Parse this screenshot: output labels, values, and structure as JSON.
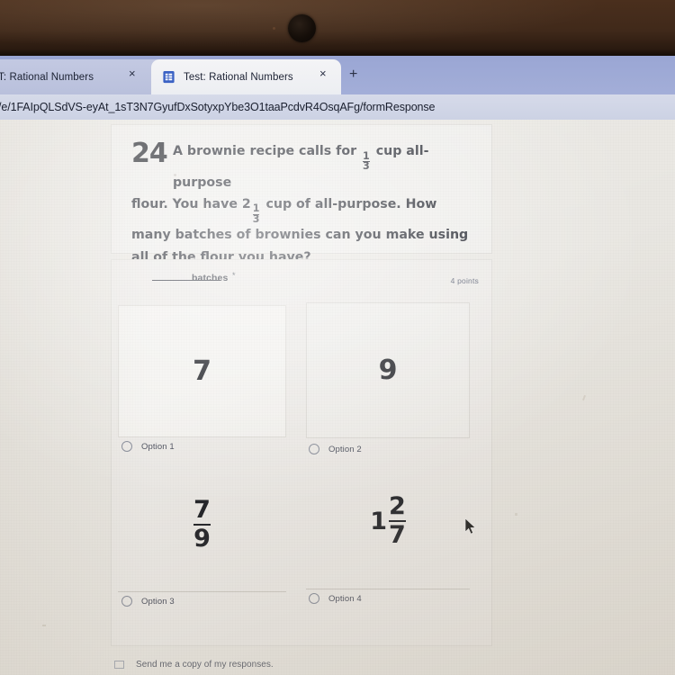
{
  "browser": {
    "tabs": [
      {
        "title": "T: Rational Numbers",
        "favicon": "forms-icon",
        "active": false,
        "close_label": "×"
      },
      {
        "title": "Test: Rational Numbers",
        "favicon": "forms-icon",
        "active": true,
        "close_label": "×"
      }
    ],
    "new_tab_label": "+",
    "url": "/e/1FAIpQLSdVS-eyAt_1sT3N7GyufDxSotyxpYbe3O1taaPcdvR4OsqAFg/formResponse"
  },
  "question": {
    "number": "24",
    "line1_pre": "A brownie recipe calls for",
    "frac1_num": "1",
    "frac1_den": "3",
    "line1_post": "cup all-purpose",
    "line2_pre": "flour.  You have 2",
    "frac2_num": "1",
    "frac2_den": "3",
    "line2_post": "cup of all-purpose.  How",
    "line3": "many batches of brownies can you make using",
    "line4": "all of the flour you have?"
  },
  "answer": {
    "label": "batches",
    "required_marker": "*",
    "points": "4 points",
    "options": [
      {
        "label": "Option 1",
        "kind": "integer",
        "value": "7"
      },
      {
        "label": "Option 2",
        "kind": "integer",
        "value": "9"
      },
      {
        "label": "Option 3",
        "kind": "fraction",
        "whole": "",
        "numerator": "7",
        "denominator": "9"
      },
      {
        "label": "Option 4",
        "kind": "mixed",
        "whole": "1",
        "numerator": "2",
        "denominator": "7"
      }
    ]
  },
  "footer": {
    "send_copy_label": "Send me a copy of my responses."
  },
  "colors": {
    "tabstrip": "#9aa6d4",
    "urlbar": "#d6dae9",
    "page_background": "#e9e7e2",
    "bezel": "#40291a",
    "text_primary": "#1a1d26",
    "text_muted": "#5b6274"
  }
}
